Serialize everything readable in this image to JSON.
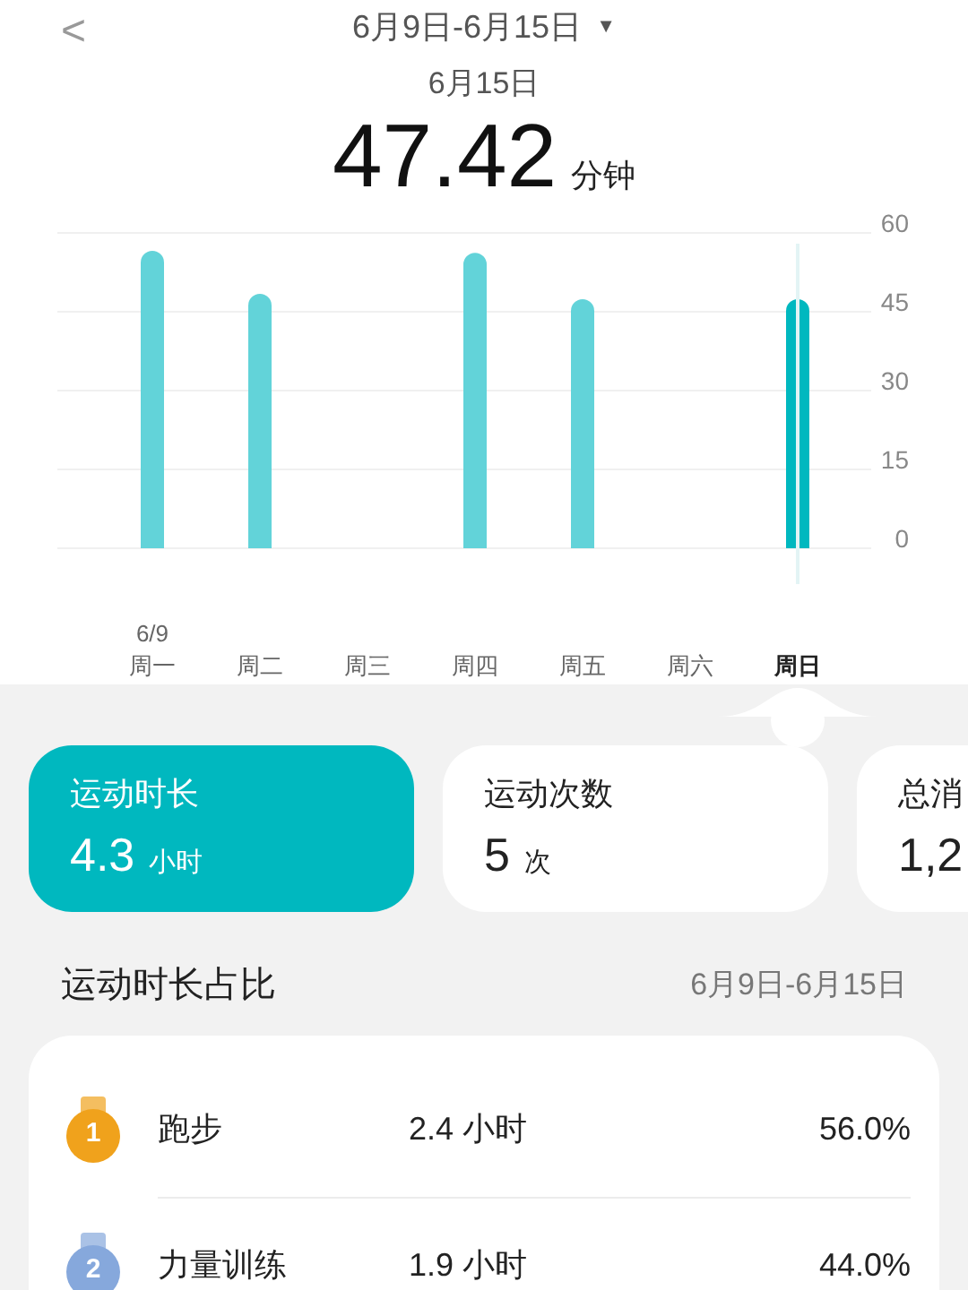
{
  "header": {
    "back": "<",
    "range": "6月9日-6月15日",
    "caret": "▼"
  },
  "summary": {
    "date": "6月15日",
    "value": "47.42",
    "unit": "分钟"
  },
  "chart": {
    "days": [
      {
        "note": "6/9",
        "selected": false
      },
      {
        "selected": false
      },
      {
        "selected": false
      },
      {
        "selected": false
      },
      {
        "selected": false
      },
      {
        "selected": false
      },
      {
        "selected": true
      }
    ],
    "chart_data": {
      "type": "bar",
      "categories": [
        "周一",
        "周二",
        "周三",
        "周四",
        "周五",
        "周六",
        "周日"
      ],
      "series": [
        {
          "color": "#62d3d9",
          "values": [
            56.6,
            48.4,
            null,
            56.2,
            47.4,
            null,
            null
          ]
        },
        {
          "color": "#00b8bf",
          "values": [
            null,
            null,
            null,
            null,
            null,
            null,
            47.4
          ]
        }
      ],
      "ylim": [
        0,
        60
      ],
      "yticks": [
        0,
        15,
        30,
        45,
        60
      ],
      "grid": true
    }
  },
  "cards": [
    {
      "label": "运动时长",
      "value": "4.3",
      "unit": "小时",
      "selected": true
    },
    {
      "label": "运动次数",
      "value": "5",
      "unit": "次",
      "selected": false
    },
    {
      "label": "总消",
      "value": "1,2",
      "selected": false
    }
  ],
  "breakdown": {
    "title": "运动时长占比",
    "range": "6月9日-6月15日",
    "rows": [
      {
        "rank": "1",
        "color": "#f0a21c",
        "name": "跑步",
        "value": "2.4 小时",
        "percent": "56.0%"
      },
      {
        "rank": "2",
        "color": "#86a8dc",
        "name": "力量训练",
        "value": "1.9 小时",
        "percent": "44.0%"
      }
    ]
  }
}
